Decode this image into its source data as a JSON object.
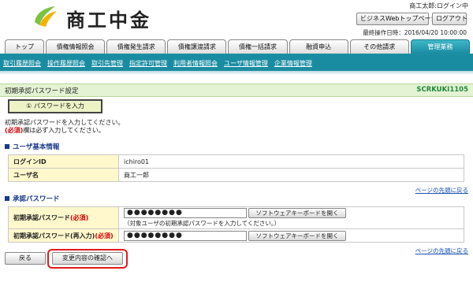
{
  "header": {
    "logo_text": "商工中金",
    "login_user": "商工太郎:ログイン中",
    "biz_top_label": "ビジネスWebトップページへ",
    "logout_label": "ログアウト",
    "last_login": "最終操作日時：2016/04/20 10:00:00"
  },
  "tabs": [
    {
      "label": "トップ"
    },
    {
      "label": "債権情報照会"
    },
    {
      "label": "債権発生請求"
    },
    {
      "label": "債権譲渡請求"
    },
    {
      "label": "債権一括請求"
    },
    {
      "label": "融資申込"
    },
    {
      "label": "その他請求"
    },
    {
      "label": "管理業務"
    }
  ],
  "subnav": [
    {
      "label": "取引履歴照会"
    },
    {
      "label": "操作履歴照会"
    },
    {
      "label": "取引先管理"
    },
    {
      "label": "指定許可管理"
    },
    {
      "label": "利用者情報照会"
    },
    {
      "label": "ユーザ情報管理"
    },
    {
      "label": "企業情報管理"
    }
  ],
  "page": {
    "title": "初期承認パスワード設定",
    "screen_id": "SCRKUKI1105",
    "step_label": "① パスワードを入力",
    "instruction_1": "初期承認パスワードを入力してください。",
    "instruction_2_req": "(必須)",
    "instruction_2": "欄は必ず入力してください。"
  },
  "user_section": {
    "heading": "ユーザ基本情報",
    "rows": [
      {
        "label": "ログインID",
        "value": "ichiro01"
      },
      {
        "label": "ユーザ名",
        "value": "商工一郎"
      }
    ],
    "pagetop": "ページの先頭に戻る"
  },
  "pw_section": {
    "heading": "承認パスワード",
    "row1_label": "初期承認パスワード",
    "row1_req": "(必須)",
    "row1_value": "●●●●●●●●",
    "row2_label": "初期承認パスワード(再入力)",
    "row2_req": "(必須)",
    "row2_value": "●●●●●●●●",
    "sw_keyboard_label": "ソフトウェアキーボードを開く",
    "note": "（対象ユーザの初期承認パスワードを入力してください。）",
    "pagetop": "ページの先頭に戻る"
  },
  "footer": {
    "back_label": "戻る",
    "confirm_label": "変更内容の確認へ"
  },
  "colors": {
    "accent_teal": "#1a8ca2",
    "highlight_red": "#e01b1b",
    "label_bg": "#fff8cc",
    "title_bg": "#e3f3d4"
  }
}
